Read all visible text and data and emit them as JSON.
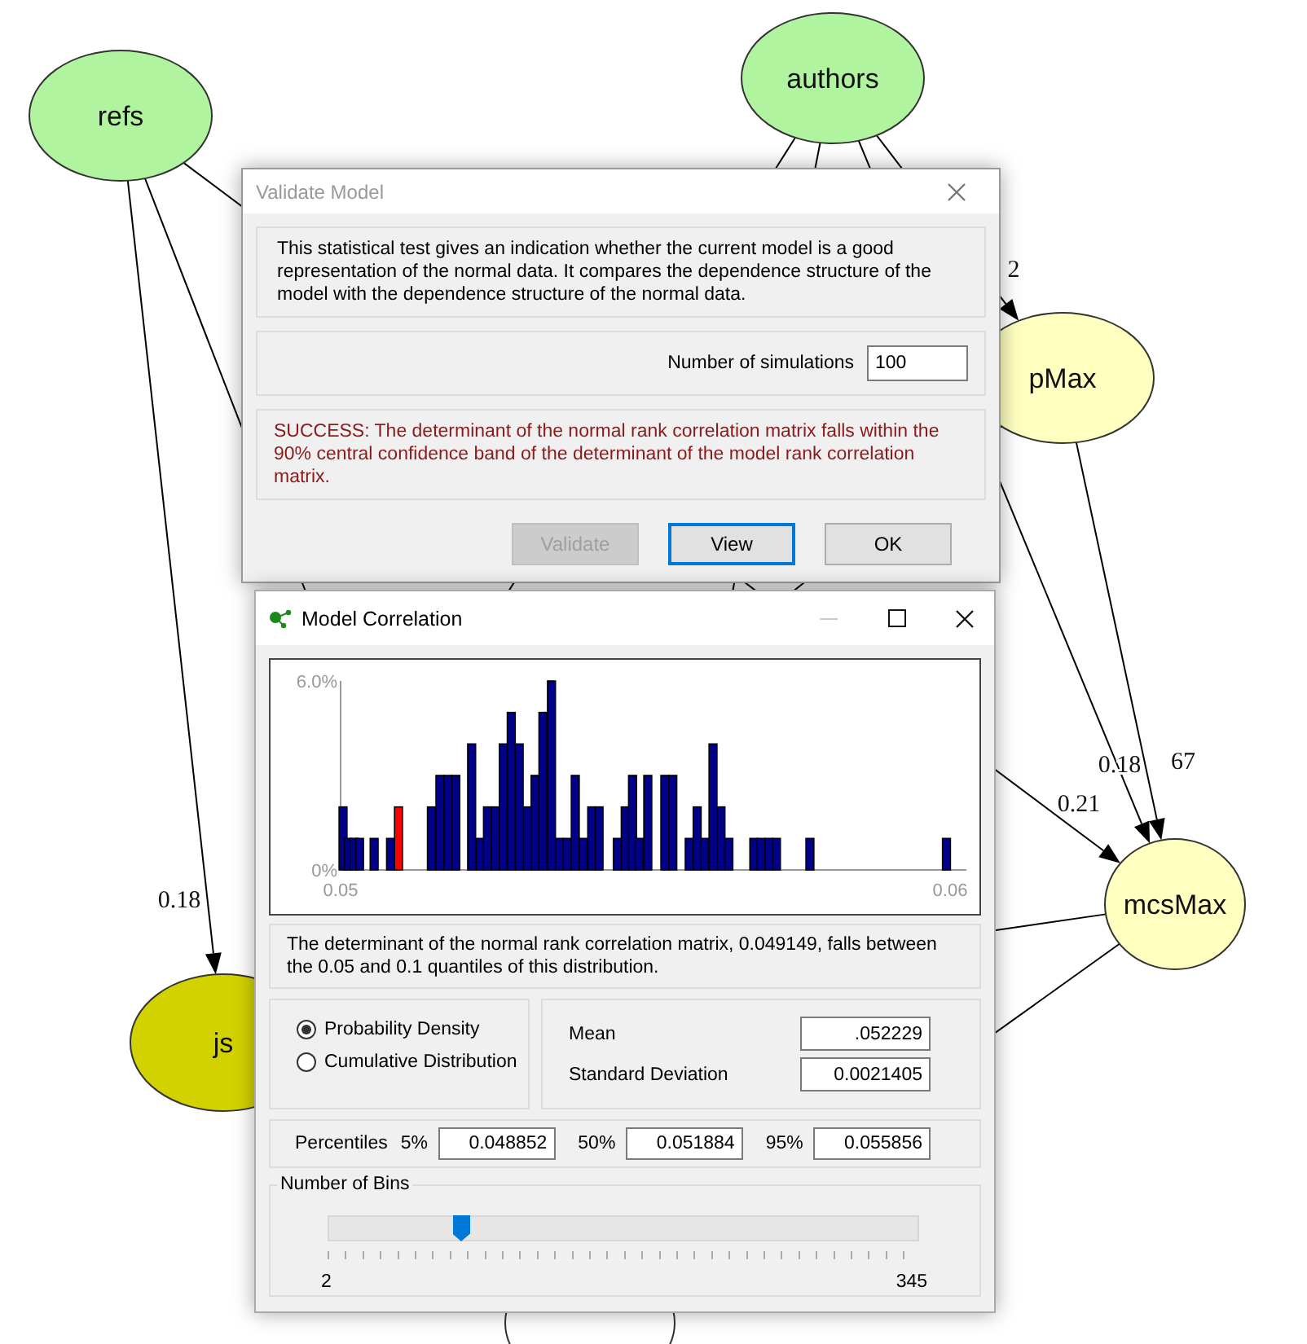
{
  "graph": {
    "nodes": [
      {
        "label": "refs",
        "color": "#b0f4a0"
      },
      {
        "label": "authors",
        "color": "#b0f4a0"
      },
      {
        "label": "pMax",
        "color": "#ffffc0"
      },
      {
        "label": "mcsMax",
        "color": "#ffffc0"
      },
      {
        "label": "js",
        "color": "#d2d200"
      },
      {
        "color": "#ffffff"
      }
    ],
    "edge_labels": [
      "0.18",
      "0.21",
      "2",
      "0.18",
      "67"
    ]
  },
  "validate_dialog": {
    "title": "Validate Model",
    "description": "This statistical test gives an indication whether the current model is a good representation of the normal data. It compares the dependence structure of the model with the dependence structure of the normal data.",
    "simulations_label": "Number of simulations",
    "simulations_value": "100",
    "result": "SUCCESS: The determinant of the normal rank correlation matrix falls within the 90% central confidence band of the determinant of the model rank correlation matrix.",
    "buttons": [
      {
        "label": "Validate",
        "disabled": true,
        "focused": false
      },
      {
        "label": "View",
        "disabled": false,
        "focused": true
      },
      {
        "label": "OK",
        "disabled": false,
        "focused": false
      }
    ]
  },
  "correlation_window": {
    "title": "Model Correlation",
    "chart_data": {
      "type": "bar",
      "xlim": [
        0.05,
        0.06
      ],
      "ylim": [
        0,
        6
      ],
      "xticks": [
        {
          "value": 0.05,
          "label": "0.05"
        },
        {
          "value": 0.06,
          "label": "0.06"
        }
      ],
      "yticks": [
        {
          "value": 0,
          "label": "0%"
        },
        {
          "value": 6,
          "label": "6.0%"
        }
      ],
      "x": [
        0.05004,
        0.05013,
        0.05022,
        0.05031,
        0.05055,
        0.05082,
        0.05095,
        0.05149,
        0.05163,
        0.05176,
        0.05189,
        0.05215,
        0.05229,
        0.05241,
        0.05254,
        0.05267,
        0.0528,
        0.05293,
        0.05306,
        0.05319,
        0.05332,
        0.05346,
        0.05359,
        0.05372,
        0.05385,
        0.05398,
        0.05412,
        0.05424,
        0.05454,
        0.05467,
        0.05479,
        0.0549,
        0.05504,
        0.05532,
        0.05545,
        0.05572,
        0.05585,
        0.05597,
        0.05611,
        0.05624,
        0.05637,
        0.05678,
        0.0569,
        0.05703,
        0.05715,
        0.0577,
        0.05994
      ],
      "series": [
        {
          "color": "#00008b",
          "values": [
            2,
            1,
            1,
            1,
            1,
            1,
            null,
            2,
            3,
            3,
            3,
            4,
            1,
            2,
            2,
            4,
            5,
            4,
            2,
            3,
            5,
            6,
            1,
            1,
            3,
            1,
            2,
            2,
            1,
            2,
            3,
            1,
            3,
            3,
            3,
            1,
            2,
            1,
            4,
            2,
            1,
            1,
            1,
            1,
            1,
            1,
            1
          ]
        },
        {
          "color": "#ff0000",
          "values": [
            null,
            null,
            null,
            null,
            null,
            null,
            2,
            null,
            null,
            null,
            null,
            null,
            null,
            null,
            null,
            null,
            null,
            null,
            null,
            null,
            null,
            null,
            null,
            null,
            null,
            null,
            null,
            null,
            null,
            null,
            null,
            null,
            null,
            null,
            null,
            null,
            null,
            null,
            null,
            null,
            null,
            null,
            null,
            null,
            null,
            null,
            null
          ]
        }
      ]
    },
    "message": "The determinant of the normal rank correlation matrix, 0.049149, falls between the 0.05 and 0.1 quantiles of this distribution.",
    "display_options": [
      {
        "label": "Probability Density",
        "selected": true
      },
      {
        "label": "Cumulative Distribution",
        "selected": false
      }
    ],
    "statistics": [
      {
        "label": "Mean",
        "value": ".052229"
      },
      {
        "label": "Standard Deviation",
        "value": "0.0021405"
      }
    ],
    "percentiles_label": "Percentiles",
    "percentiles": [
      {
        "label": "5%",
        "value": "0.048852"
      },
      {
        "label": "50%",
        "value": "0.051884"
      },
      {
        "label": "95%",
        "value": "0.055856"
      }
    ],
    "bins": {
      "label": "Number of Bins",
      "level": 0.223,
      "min_label": "2",
      "max_label": "345"
    }
  }
}
